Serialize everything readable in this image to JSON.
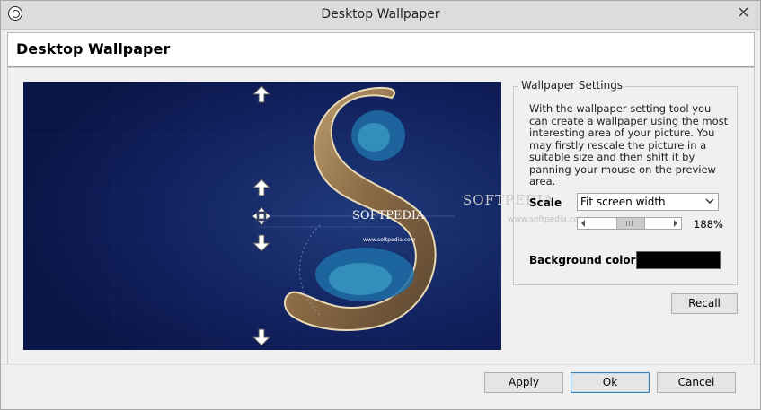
{
  "window": {
    "title": "Desktop Wallpaper",
    "app_icon": "app-icon",
    "close_icon": "close-icon"
  },
  "header": {
    "title": "Desktop Wallpaper"
  },
  "preview": {
    "watermark": "SOFTPEDIA",
    "url_text": "www.softpedia.com",
    "watermark_overflow": "SOFTPEDIA",
    "overflow_url": "www.softpedia.com",
    "background_color": "#0d1a4e",
    "pan_arrows": [
      "up-arrow-icon",
      "down-arrow-icon",
      "move-icon"
    ]
  },
  "settings": {
    "group_title": "Wallpaper Settings",
    "description": "With the wallpaper setting tool you can create a wallpaper using the most interesting area of your picture. You may firstly rescale the picture in a suitable size and then shift it by panning your mouse on the preview area.",
    "scale_label": "Scale",
    "scale_selected": "Fit screen width",
    "scale_percent": "188%",
    "scale_slider_position": 0.5,
    "background_label": "Background color",
    "background_color": "#000000"
  },
  "buttons": {
    "recall": "Recall",
    "apply": "Apply",
    "ok": "Ok",
    "cancel": "Cancel"
  }
}
